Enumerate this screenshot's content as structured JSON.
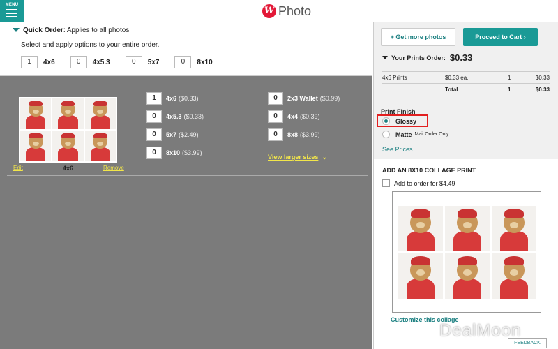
{
  "header": {
    "menu_label": "MENU",
    "logo_mark": "W",
    "logo_text": "Photo"
  },
  "quick_order": {
    "title_bold": "Quick Order",
    "title_rest": ": Applies to all photos",
    "subtitle": "Select and apply options to your entire order.",
    "items": [
      {
        "qty": "1",
        "label": "4x6"
      },
      {
        "qty": "0",
        "label": "4x5.3"
      },
      {
        "qty": "0",
        "label": "5x7"
      },
      {
        "qty": "0",
        "label": "8x10"
      }
    ]
  },
  "photo": {
    "edit_label": "Edit",
    "size_label": "4x6",
    "remove_label": "Remove",
    "sizes_col1": [
      {
        "qty": "1",
        "size": "4x6",
        "price": "($0.33)"
      },
      {
        "qty": "0",
        "size": "4x5.3",
        "price": "($0.33)"
      },
      {
        "qty": "0",
        "size": "5x7",
        "price": "($2.49)"
      },
      {
        "qty": "0",
        "size": "8x10",
        "price": "($3.99)"
      }
    ],
    "sizes_col2": [
      {
        "qty": "0",
        "size": "2x3 Wallet",
        "price": "($0.99)"
      },
      {
        "qty": "0",
        "size": "4x4",
        "price": "($0.39)"
      },
      {
        "qty": "0",
        "size": "8x8",
        "price": "($3.99)"
      }
    ],
    "view_larger": "View larger sizes"
  },
  "sidebar": {
    "more_photos": "+ Get more photos",
    "proceed_cart": "Proceed to Cart",
    "order_label": "Your Prints Order:",
    "order_total": "$0.33",
    "rows": [
      {
        "item": "4x6 Prints",
        "price": "$0.33 ea.",
        "qty": "1",
        "amount": "$0.33"
      },
      {
        "item": "",
        "price": "Total",
        "qty": "1",
        "amount": "$0.33"
      }
    ],
    "finish_title": "Print Finish",
    "glossy": "Glossy",
    "matte": "Matte",
    "mail_only": "Mail Order Only",
    "see_prices": "See Prices",
    "collage_title": "ADD AN 8X10 COLLAGE PRINT",
    "add_order": "Add to order for $4.49",
    "customize": "Customize this collage"
  },
  "overlay": {
    "watermark": "DealMoon",
    "feedback": "FEEDBACK"
  },
  "colors": {
    "teal": "#1a9a96",
    "link_yellow": "#f2e64a",
    "highlight_red": "#e21f1f",
    "main_gray": "#7b7b7b"
  }
}
